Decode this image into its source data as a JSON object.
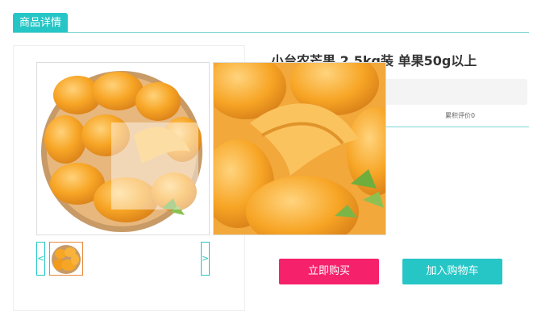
{
  "header": {
    "tab_label": "商品详情"
  },
  "product": {
    "title": "小台农芒果 2.5kg装 单果50g以上",
    "review_count": "累积评价0"
  },
  "gallery": {
    "prev_label": "<",
    "next_label": ">"
  },
  "actions": {
    "buy_now_label": "立即购买",
    "add_to_cart_label": "加入购物车"
  },
  "colors": {
    "accent": "#26c6c6",
    "buy": "#f5226b",
    "thumbnail_border": "#e8893a"
  }
}
